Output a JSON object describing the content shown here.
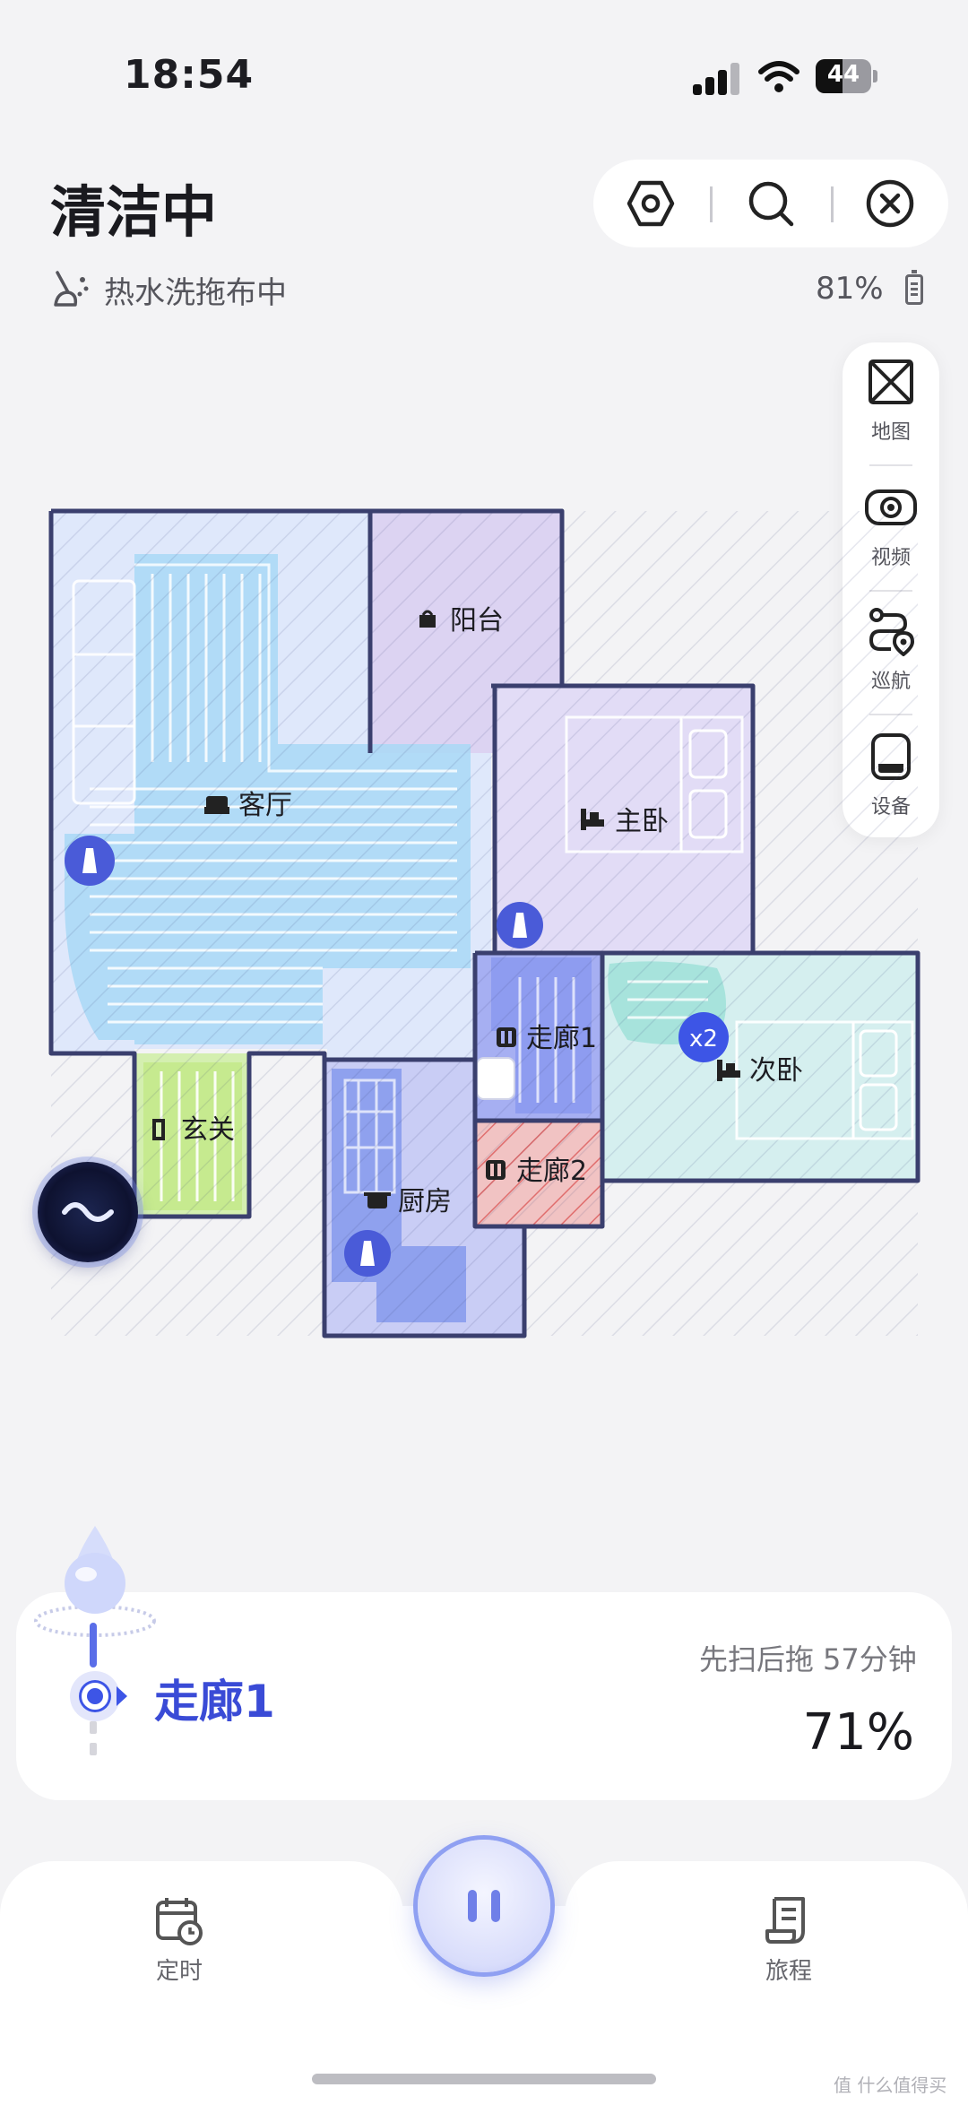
{
  "status_bar": {
    "time": "18:54",
    "battery": "44"
  },
  "header": {
    "title": "清洁中"
  },
  "sub_status": {
    "text": "热水洗拖布中",
    "battery_percent": "81%"
  },
  "side_panel": {
    "items": [
      {
        "label": "地图",
        "icon": "map-icon"
      },
      {
        "label": "视频",
        "icon": "camera-icon"
      },
      {
        "label": "巡航",
        "icon": "cruise-route-icon"
      },
      {
        "label": "设备",
        "icon": "device-icon"
      }
    ]
  },
  "map": {
    "rooms": [
      {
        "name": "阳台",
        "icon": "balcony-icon",
        "color": "#dcd3f2"
      },
      {
        "name": "客厅",
        "icon": "sofa-icon",
        "color": "#dfe8fb"
      },
      {
        "name": "主卧",
        "icon": "bed-icon",
        "color": "#e2dcf6"
      },
      {
        "name": "走廊1",
        "icon": "corridor-icon",
        "color": "#a6aff2"
      },
      {
        "name": "次卧",
        "icon": "bed-icon",
        "color": "#d5efef"
      },
      {
        "name": "玄关",
        "icon": "door-icon",
        "color": "#d4efb0"
      },
      {
        "name": "走廊2",
        "icon": "corridor-icon",
        "color": "#f1c3c3"
      },
      {
        "name": "厨房",
        "icon": "pot-icon",
        "color": "#c9cdf5"
      }
    ],
    "badge": "x2"
  },
  "progress": {
    "current_room": "走廊1",
    "mode": "先扫后拖",
    "duration": "57分钟",
    "percent": "71%"
  },
  "bottom_bar": {
    "left_label": "定时",
    "right_label": "旅程"
  },
  "watermark": "值 什么值得买",
  "colors": {
    "accent": "#3d55e6",
    "room_outline": "#3a3f6e"
  }
}
